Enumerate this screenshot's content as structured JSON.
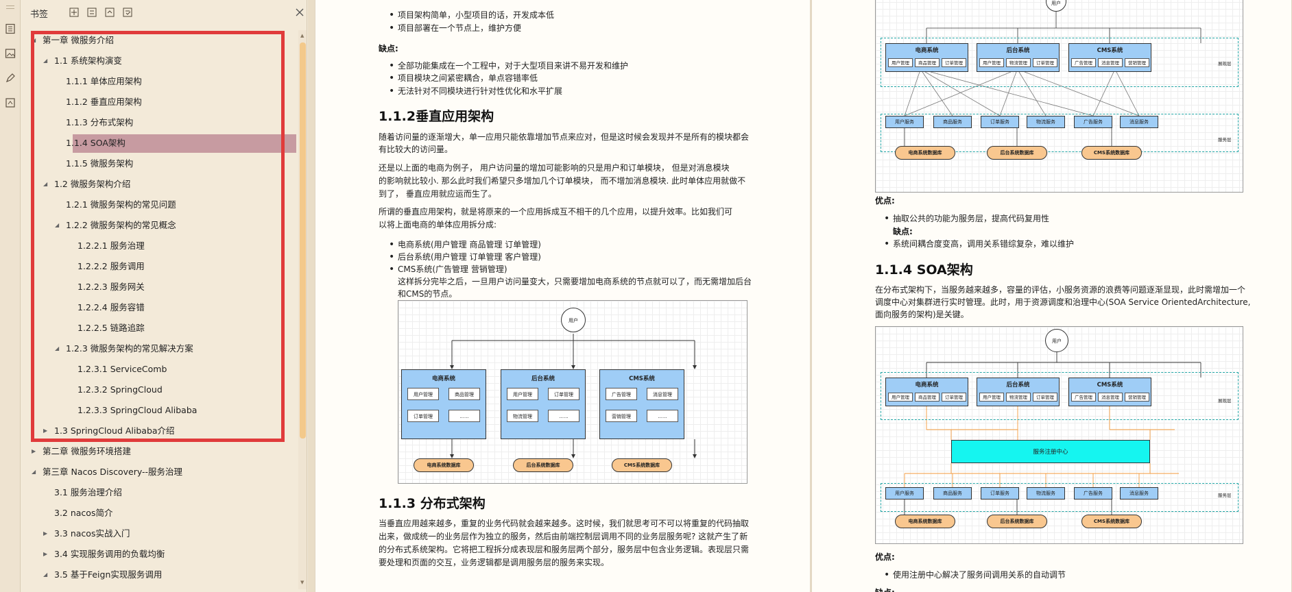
{
  "panel": {
    "title": "书签",
    "tree": [
      {
        "level": 0,
        "caret": "expanded",
        "label": "第一章 微服务介绍"
      },
      {
        "level": 1,
        "caret": "expanded",
        "label": "1.1 系统架构演变"
      },
      {
        "level": 2,
        "caret": "none",
        "label": "1.1.1 单体应用架构"
      },
      {
        "level": 2,
        "caret": "none",
        "label": "1.1.2 垂直应用架构"
      },
      {
        "level": 2,
        "caret": "none",
        "label": "1.1.3 分布式架构"
      },
      {
        "level": 2,
        "caret": "none",
        "label": "1.1.4 SOA架构",
        "selected": true
      },
      {
        "level": 2,
        "caret": "none",
        "label": "1.1.5 微服务架构"
      },
      {
        "level": 1,
        "caret": "expanded",
        "label": "1.2 微服务架构介绍"
      },
      {
        "level": 2,
        "caret": "none",
        "label": "1.2.1 微服务架构的常见问题"
      },
      {
        "level": 2,
        "caret": "expanded",
        "label": "1.2.2 微服务架构的常见概念"
      },
      {
        "level": 3,
        "caret": "none",
        "label": "1.2.2.1 服务治理"
      },
      {
        "level": 3,
        "caret": "none",
        "label": "1.2.2.2 服务调用"
      },
      {
        "level": 3,
        "caret": "none",
        "label": "1.2.2.3 服务网关"
      },
      {
        "level": 3,
        "caret": "none",
        "label": "1.2.2.4 服务容错"
      },
      {
        "level": 3,
        "caret": "none",
        "label": "1.2.2.5 链路追踪"
      },
      {
        "level": 2,
        "caret": "expanded",
        "label": "1.2.3 微服务架构的常见解决方案"
      },
      {
        "level": 3,
        "caret": "none",
        "label": "1.2.3.1 ServiceComb"
      },
      {
        "level": 3,
        "caret": "none",
        "label": "1.2.3.2 SpringCloud"
      },
      {
        "level": 3,
        "caret": "none",
        "label": "1.2.3.3 SpringCloud Alibaba"
      },
      {
        "level": 1,
        "caret": "collapsed",
        "label": "1.3 SpringCloud Alibaba介绍"
      },
      {
        "level": 0,
        "caret": "collapsed",
        "label": "第二章 微服务环境搭建"
      },
      {
        "level": 0,
        "caret": "expanded",
        "label": "第三章 Nacos Discovery--服务治理"
      },
      {
        "level": 1,
        "caret": "none",
        "label": "3.1 服务治理介绍"
      },
      {
        "level": 1,
        "caret": "none",
        "label": "3.2 nacos简介"
      },
      {
        "level": 1,
        "caret": "collapsed",
        "label": "3.3 nacos实战入门"
      },
      {
        "level": 1,
        "caret": "collapsed",
        "label": "3.4 实现服务调用的负载均衡"
      },
      {
        "level": 1,
        "caret": "expanded",
        "label": "3.5 基于Feign实现服务调用"
      }
    ]
  },
  "page1": {
    "p1_b1": "项目架构简单，小型项目的话，开发成本低",
    "p1_b2": "项目部署在一个节点上，维护方便",
    "cons_label": "缺点:",
    "p1_b3": "全部功能集成在一个工程中，对于大型项目来讲不易开发和维护",
    "p1_b4": "项目模块之间紧密耦合，单点容错率低",
    "p1_b5": "无法针对不同模块进行针对性优化和水平扩展",
    "h_112": "1.1.2垂直应用架构",
    "para1a": "随着访问量的逐渐增大，单一应用只能依靠增加节点来应对，但是这时候会发现并不是所有的模块都会",
    "para1b": "有比较大的访问量。",
    "para2a": "还是以上面的电商为例子，  用户访问量的增加可能影响的只是用户和订单模块，  但是对消息模块",
    "para2b": "的影响就比较小. 那么此时我们希望只多增加几个订单模块，  而不增加消息模块. 此时单体应用就做不",
    "para2c": "到了，  垂直应用就应运而生了。",
    "para3a": "所谓的垂直应用架构，就是将原来的一个应用拆成互不相干的几个应用，以提升效率。比如我们可",
    "para3b": "以将上面电商的单体应用拆分成:",
    "b_ec": "电商系统(用户管理 商品管理 订单管理)",
    "b_bg": "后台系统(用户管理 订单管理 客户管理)",
    "b_cms": "CMS系统(广告管理 营销管理)",
    "para4a": "这样拆分完毕之后，一旦用户访问量变大，只需要增加电商系统的节点就可以了，而无需增加后台",
    "para4b": "和CMS的节点。",
    "h_113": "1.1.3 分布式架构",
    "para5a": "当垂直应用越来越多，重复的业务代码就会越来越多。这时候，我们就思考可不可以将重复的代码抽取",
    "para5b": "出来，做成统一的业务层作为独立的服务，然后由前端控制层调用不同的业务层服务呢? 这就产生了新",
    "para5c": "的分布式系统架构。它将把工程拆分成表现层和服务层两个部分，服务层中包含业务逻辑。表现层只需",
    "para5d": "要处理和页面的交互，业务逻辑都是调用服务层的服务来实现。"
  },
  "diagram1": {
    "user": "用户",
    "systems": [
      {
        "title": "电商系统",
        "mods": [
          "用户管理",
          "商品管理",
          "订单管理",
          "......"
        ],
        "db": "电商系统数据库"
      },
      {
        "title": "后台系统",
        "mods": [
          "用户管理",
          "订单管理",
          "物流管理",
          "......"
        ],
        "db": "后台系统数据库"
      },
      {
        "title": "CMS系统",
        "mods": [
          "广告管理",
          "消息管理",
          "营销管理",
          "......"
        ],
        "db": "CMS系统数据库"
      }
    ]
  },
  "page2": {
    "pros_label": "优点:",
    "b_pro1": "抽取公共的功能为服务层，提高代码复用性",
    "cons_label": "缺点:",
    "b_con1": "系统间耦合度变高，调用关系错综复杂，难以维护",
    "h_114": "1.1.4 SOA架构",
    "para1a": "在分布式架构下，当服务越来越多，容量的评估，小服务资源的浪费等问题逐渐显现，此时需增加一个",
    "para1b": "调度中心对集群进行实时管理。此时，用于资源调度和治理中心(SOA Service OrientedArchitecture,",
    "para1c": "面向服务的架构)是关键。",
    "pros2_label": "优点:",
    "b_pro2": "使用注册中心解决了服务间调用关系的自动调节",
    "cut_label": "缺点:"
  },
  "diagram2": {
    "user": "用户",
    "presentation_label": "展现层",
    "service_label": "服务层",
    "systems": [
      {
        "title": "电商系统",
        "mods": [
          "用户管理",
          "商品管理",
          "订单管理"
        ]
      },
      {
        "title": "后台系统",
        "mods": [
          "用户管理",
          "物流管理",
          "订单管理"
        ]
      },
      {
        "title": "CMS系统",
        "mods": [
          "广告管理",
          "消息管理",
          "营销管理"
        ]
      }
    ],
    "services": [
      "用户服务",
      "商品服务",
      "订单服务",
      "物流服务",
      "广告服务",
      "消息服务"
    ],
    "dbs": [
      "电商系统数据库",
      "后台系统数据库",
      "CMS系统数据库"
    ]
  },
  "diagram3": {
    "user": "用户",
    "presentation_label": "展现层",
    "service_label": "服务层",
    "registry": "服务注册中心",
    "systems": [
      {
        "title": "电商系统",
        "mods": [
          "用户管理",
          "商品管理",
          "订单管理"
        ]
      },
      {
        "title": "后台系统",
        "mods": [
          "用户管理",
          "物流管理",
          "订单管理"
        ]
      },
      {
        "title": "CMS系统",
        "mods": [
          "广告管理",
          "消息管理",
          "营销管理"
        ]
      }
    ],
    "services": [
      "用户服务",
      "商品服务",
      "订单服务",
      "物流服务",
      "广告服务",
      "消息服务"
    ],
    "dbs": [
      "电商系统数据库",
      "后台系统数据库",
      "CMS系统数据库"
    ]
  }
}
